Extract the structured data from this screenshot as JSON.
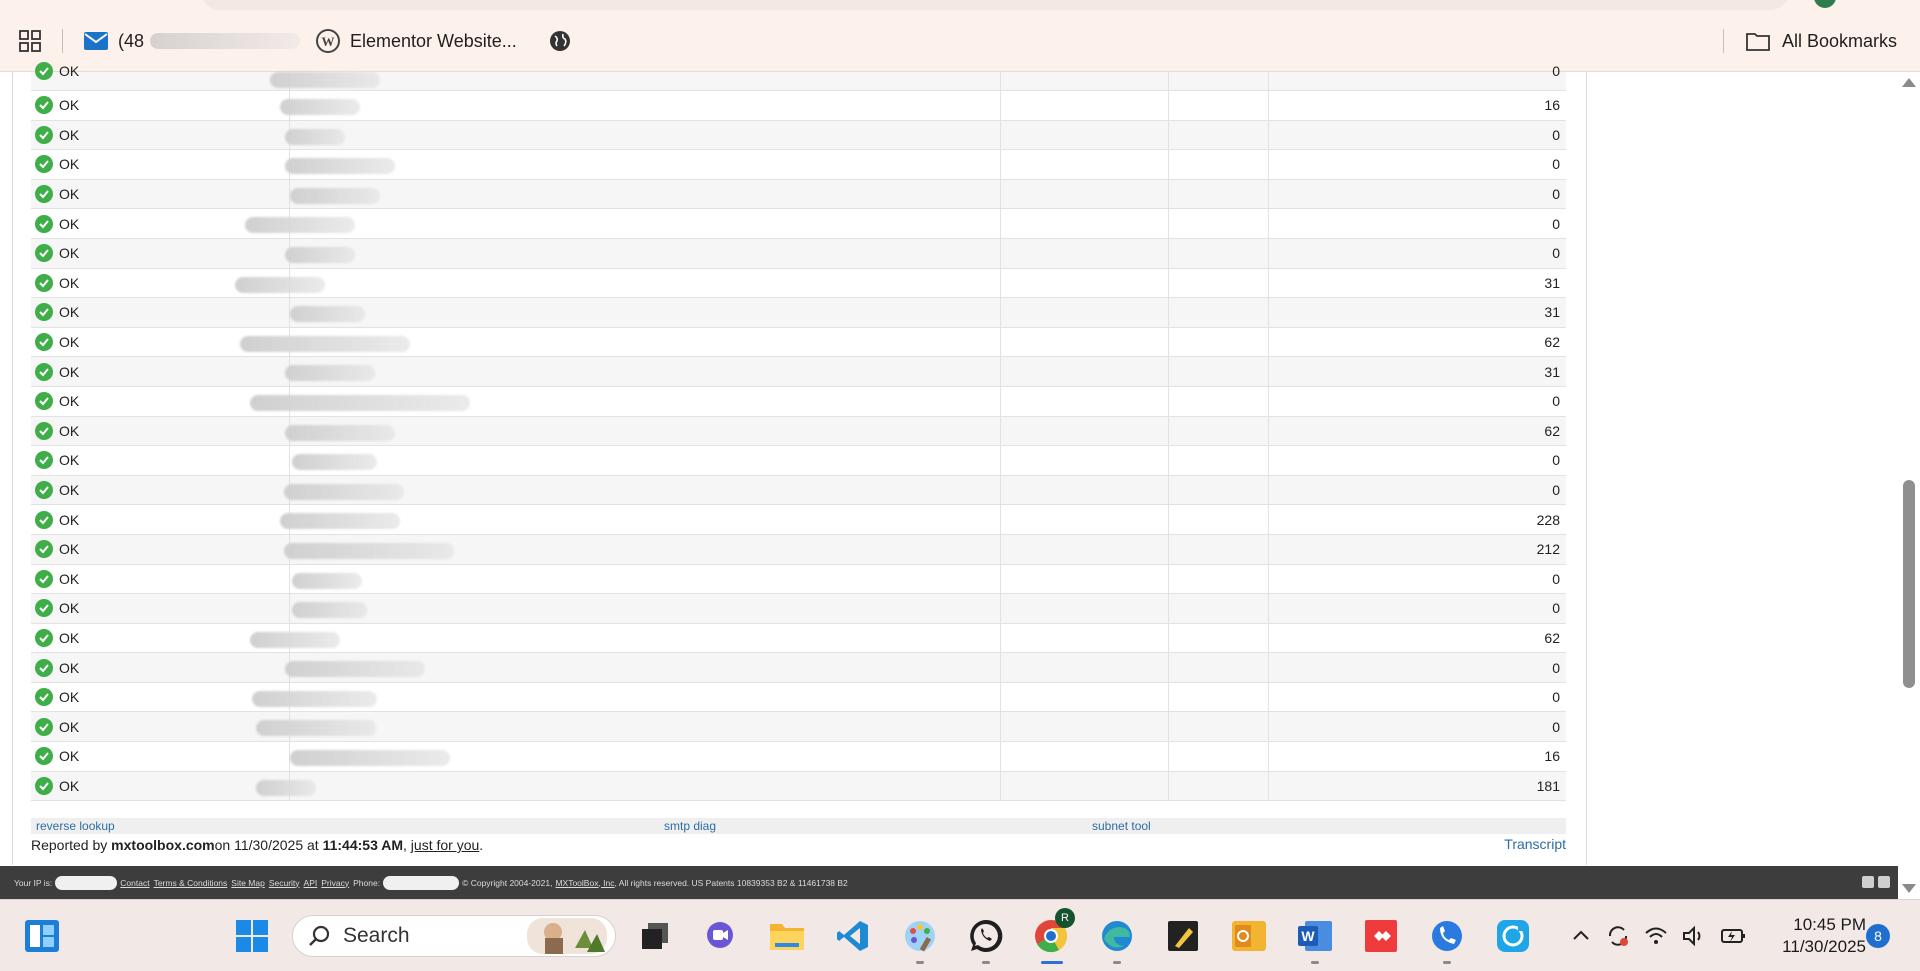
{
  "bookmarks_bar": {
    "gmail_label": "(48",
    "elementor_label": "Elementor Website...",
    "all_bookmarks_label": "All Bookmarks"
  },
  "results": {
    "rows": [
      {
        "status": "OK",
        "name": "",
        "value": "0"
      },
      {
        "status": "OK",
        "name": "",
        "value": "16"
      },
      {
        "status": "OK",
        "name": "",
        "value": "0"
      },
      {
        "status": "OK",
        "name": "",
        "value": "0"
      },
      {
        "status": "OK",
        "name": "",
        "value": "0"
      },
      {
        "status": "OK",
        "name": "",
        "value": "0"
      },
      {
        "status": "OK",
        "name": "",
        "value": "0"
      },
      {
        "status": "OK",
        "name": "",
        "value": "31"
      },
      {
        "status": "OK",
        "name": "",
        "value": "31"
      },
      {
        "status": "OK",
        "name": "",
        "value": "62"
      },
      {
        "status": "OK",
        "name": "",
        "value": "31"
      },
      {
        "status": "OK",
        "name": "",
        "value": "0"
      },
      {
        "status": "OK",
        "name": "",
        "value": "62"
      },
      {
        "status": "OK",
        "name": "",
        "value": "0"
      },
      {
        "status": "OK",
        "name": "",
        "value": "0"
      },
      {
        "status": "OK",
        "name": "",
        "value": "228"
      },
      {
        "status": "OK",
        "name": "",
        "value": "212"
      },
      {
        "status": "OK",
        "name": "",
        "value": "0"
      },
      {
        "status": "OK",
        "name": "",
        "value": "0"
      },
      {
        "status": "OK",
        "name": "",
        "value": "62"
      },
      {
        "status": "OK",
        "name": "",
        "value": "0"
      },
      {
        "status": "OK",
        "name": "",
        "value": "0"
      },
      {
        "status": "OK",
        "name": "",
        "value": "0"
      },
      {
        "status": "OK",
        "name": "",
        "value": "16"
      },
      {
        "status": "OK",
        "name": "",
        "value": "181"
      }
    ]
  },
  "tools": {
    "reverse_lookup": "reverse lookup",
    "smtp_diag": "smtp diag",
    "subnet_tool": "subnet tool"
  },
  "report": {
    "prefix": "Reported by ",
    "site": "mxtoolbox.com",
    "on": " on 11/30/2025 at ",
    "time": "11:44:53 AM",
    "comma": ", ",
    "just_for_you": "just for you",
    "period": ".",
    "transcript": "Transcript"
  },
  "footer": {
    "your_ip": "Your IP is:",
    "contact": "Contact",
    "terms": "Terms & Conditions",
    "site_map": "Site Map",
    "security": "Security",
    "api": "API",
    "privacy": "Privacy",
    "phone": "Phone:",
    "copyright": "© Copyright 2004-2021,",
    "mxtoolbox_inc": "MXToolBox, Inc",
    "rights": ", All rights reserved. US Patents 10839353 B2 & 11461738 B2"
  },
  "taskbar": {
    "search_label": "Search",
    "time": "10:45 PM",
    "date": "11/30/2025",
    "notification_count": "8",
    "chrome_profile_letter": "R"
  },
  "colors": {
    "ok_green": "#3fae49",
    "link_blue": "#2e6da4",
    "footer_bg": "#3d3d3d",
    "chrome_bg": "#fdf1ec",
    "taskbar_bg": "#f2e9e6"
  }
}
